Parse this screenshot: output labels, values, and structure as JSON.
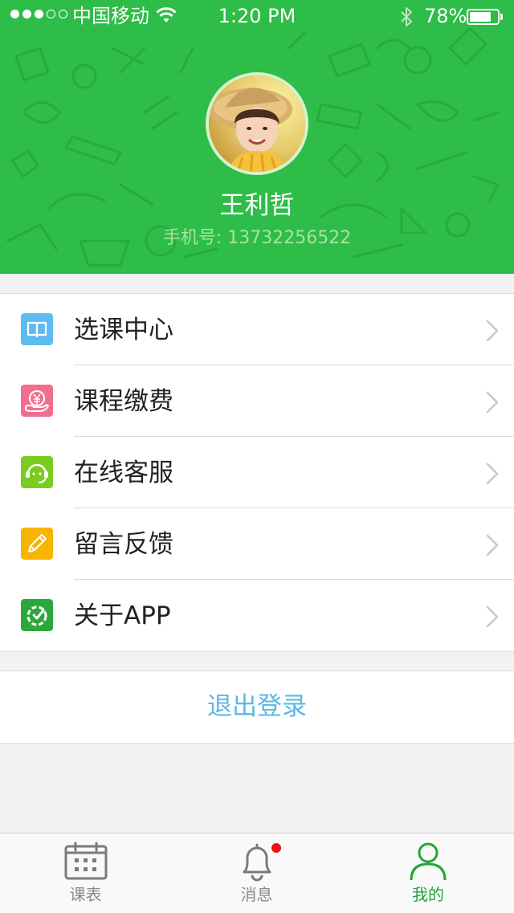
{
  "status_bar": {
    "signal": [
      true,
      true,
      true,
      false,
      false
    ],
    "carrier": "中国移动",
    "time": "1:20 PM",
    "battery": "78%",
    "battery_level": 0.78
  },
  "profile": {
    "name": "王利哲",
    "phone_label": "手机号:",
    "phone": "13732256522",
    "phone_text": "手机号: 13732256522"
  },
  "menu": {
    "items": [
      {
        "label": "选课中心",
        "icon": "book-icon",
        "color": "#5dbbf2"
      },
      {
        "label": "课程缴费",
        "icon": "payment-icon",
        "color": "#f06e8e"
      },
      {
        "label": "在线客服",
        "icon": "chat-icon",
        "color": "#7ccc1f"
      },
      {
        "label": "留言反馈",
        "icon": "pencil-icon",
        "color": "#f7b400"
      },
      {
        "label": "关于APP",
        "icon": "app-logo-icon",
        "color": "#2ba83b"
      }
    ]
  },
  "logout_label": "退出登录",
  "tabbar": {
    "tabs": [
      {
        "label": "课表",
        "icon": "calendar-icon",
        "active": false
      },
      {
        "label": "消息",
        "icon": "bell-icon",
        "active": false,
        "badge": true
      },
      {
        "label": "我的",
        "icon": "person-icon",
        "active": true
      }
    ]
  },
  "colors": {
    "header_green": "#2dbd48",
    "active_tab": "#24a536",
    "inactive_tab": "#8a8a8a",
    "logout_text": "#5bb8e6"
  }
}
